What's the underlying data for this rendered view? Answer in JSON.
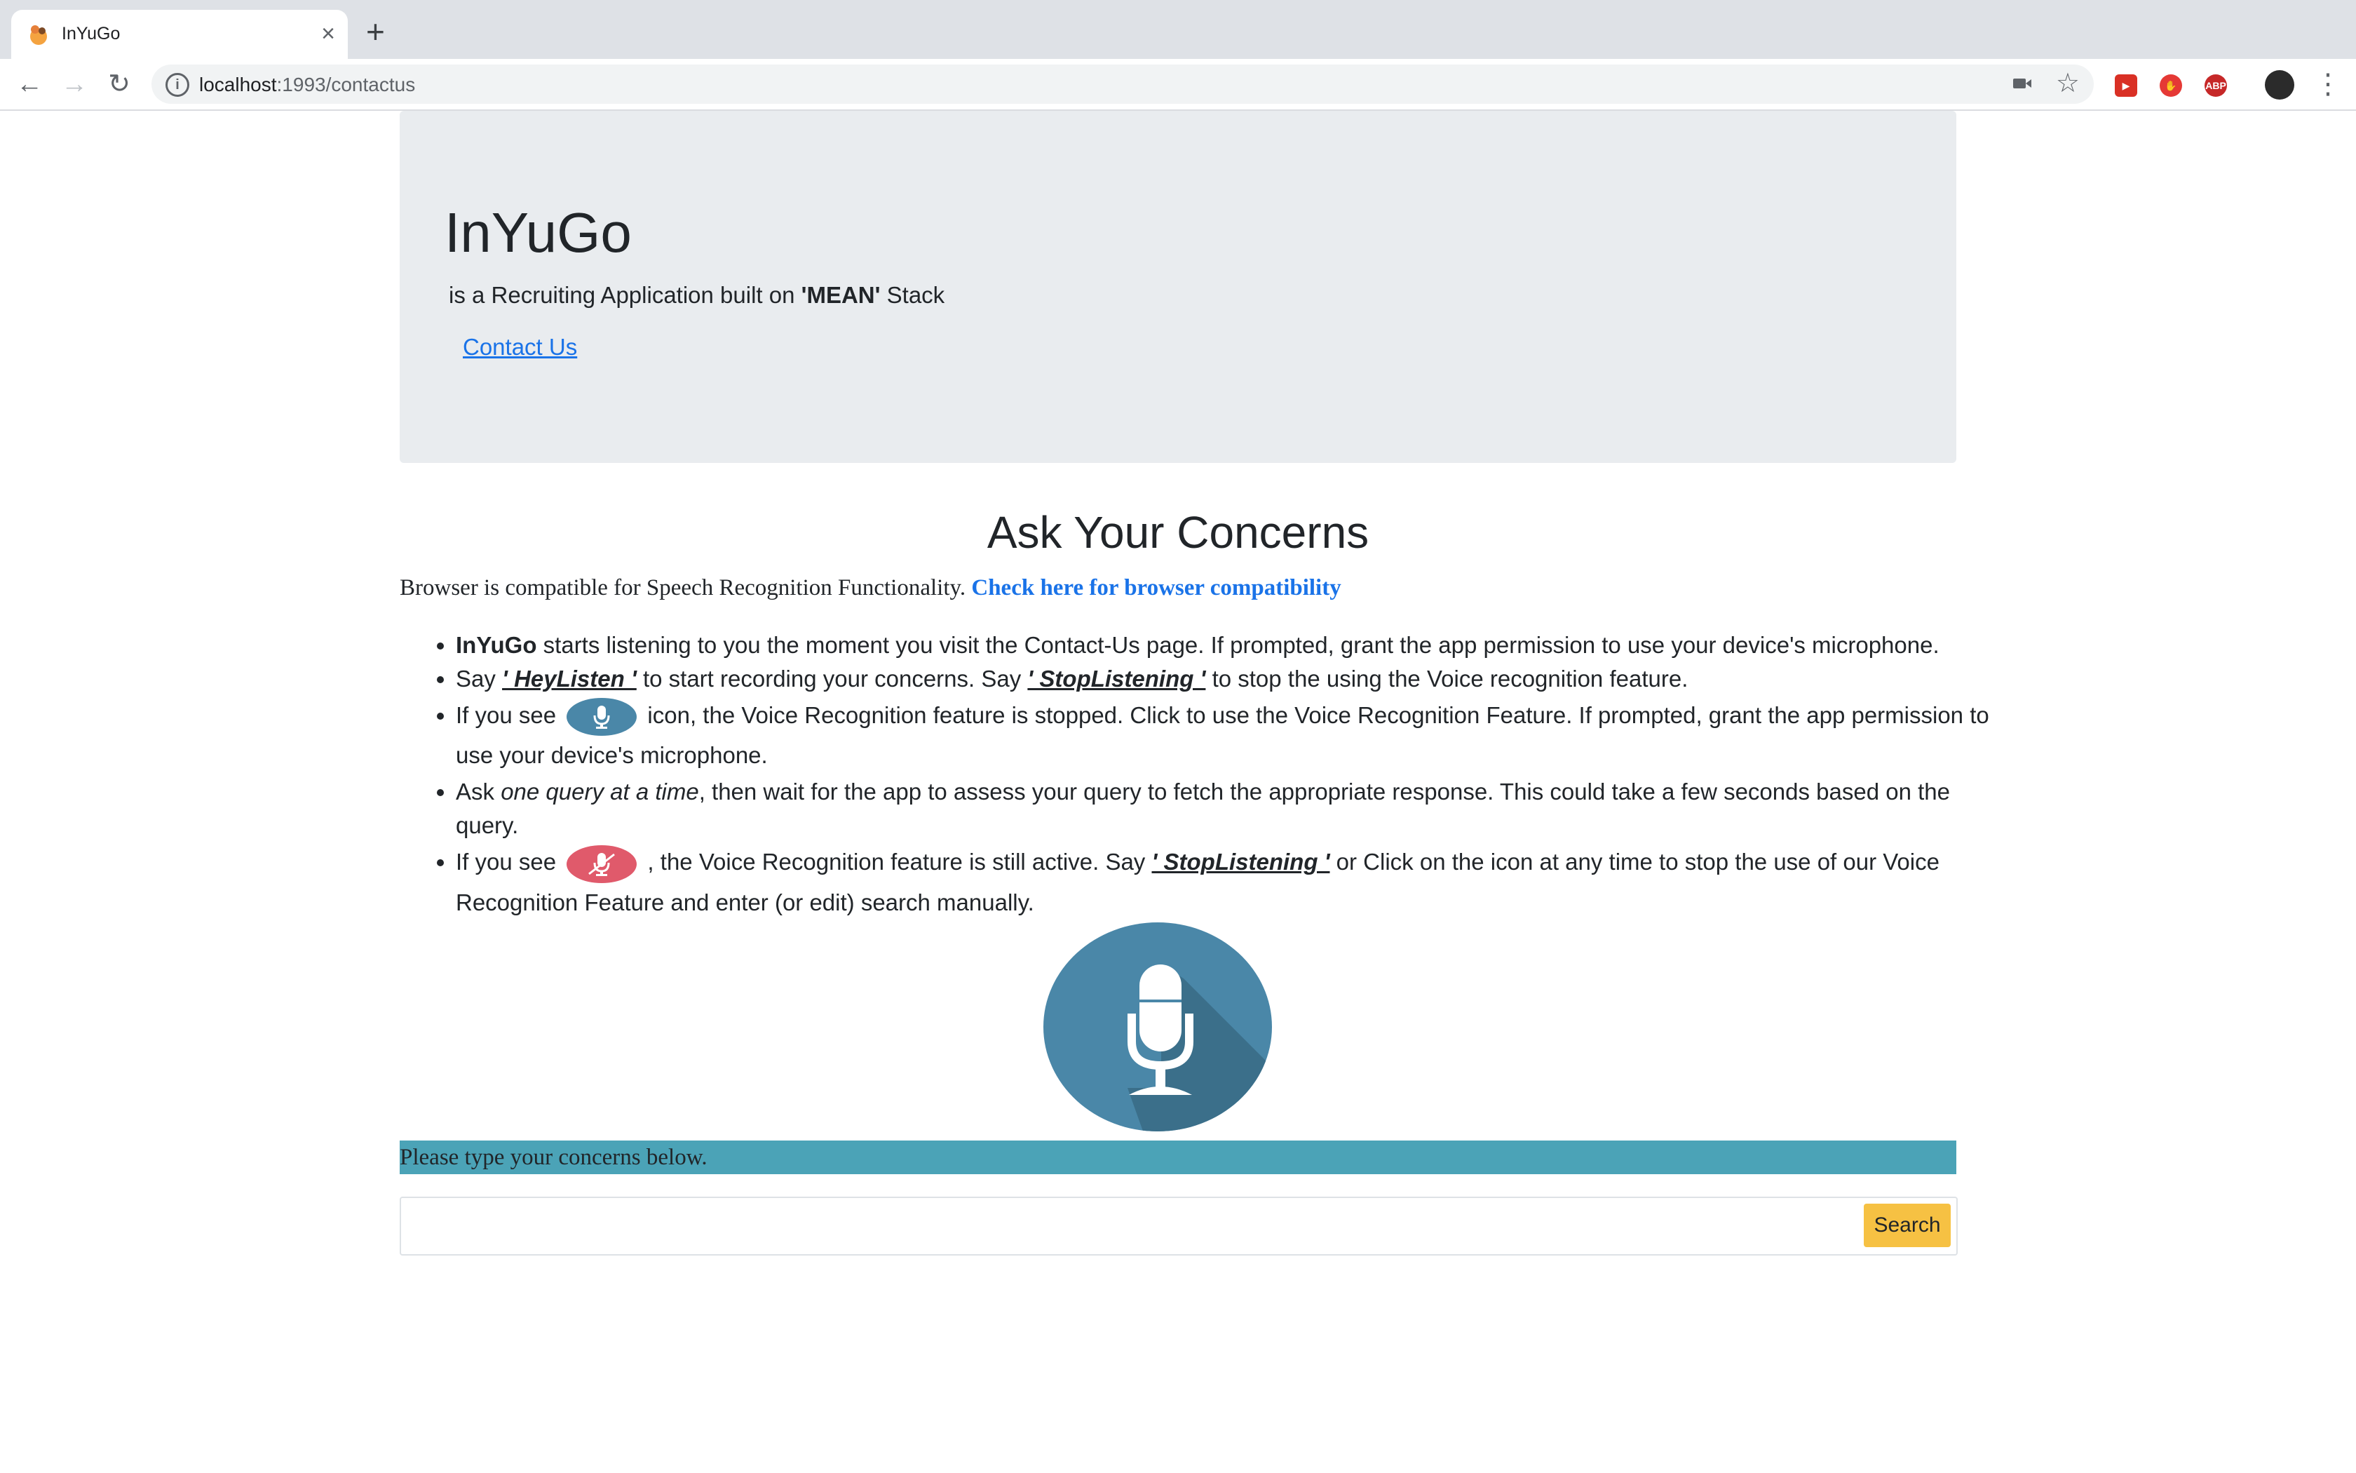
{
  "browser": {
    "tab_title": "InYuGo",
    "url_host": "localhost",
    "url_path": ":1993/contactus"
  },
  "jumbotron": {
    "title": "InYuGo",
    "subtitle_prefix": "is a Recruiting Application built on ",
    "subtitle_bold": "'MEAN'",
    "subtitle_suffix": " Stack",
    "contact_link": "Contact Us"
  },
  "main": {
    "heading": "Ask Your Concerns",
    "compat_text": "Browser is compatible for Speech Recognition Functionality. ",
    "compat_link": "Check here for browser compatibility",
    "instructions": {
      "item1_bold": "InYuGo",
      "item1_text": " starts listening to you the moment you visit the Contact-Us page. If prompted, grant the app permission to use your device's microphone.",
      "item2_a": "Say ",
      "item2_kw1": "' HeyListen '",
      "item2_b": " to start recording your concerns. Say ",
      "item2_kw2": "' StopListening '",
      "item2_c": " to stop the using the Voice recognition feature.",
      "item3_a": "If you see",
      "item3_b": " icon, the Voice Recognition feature is stopped. Click to use the Voice Recognition Feature. If prompted, grant the app permission to use your device's microphone.",
      "item4_a": "Ask ",
      "item4_em": "one query at a time",
      "item4_b": ", then wait for the app to assess your query to fetch the appropriate response. This could take a few seconds based on the query.",
      "item5_a": "If you see",
      "item5_b": " , the Voice Recognition feature is still active. Say ",
      "item5_kw": "' StopListening '",
      "item5_c": " or Click on the icon at any time to stop the use of our Voice Recognition Feature and enter (or edit) search manually."
    },
    "banner": "Please type your concerns below.",
    "search_value": "",
    "search_button": "Search"
  },
  "colors": {
    "mic_blue": "#4a87a8",
    "mic_red": "#e05a6b",
    "banner": "#4ba3b7",
    "button": "#f6c143",
    "link": "#1a73e8"
  }
}
